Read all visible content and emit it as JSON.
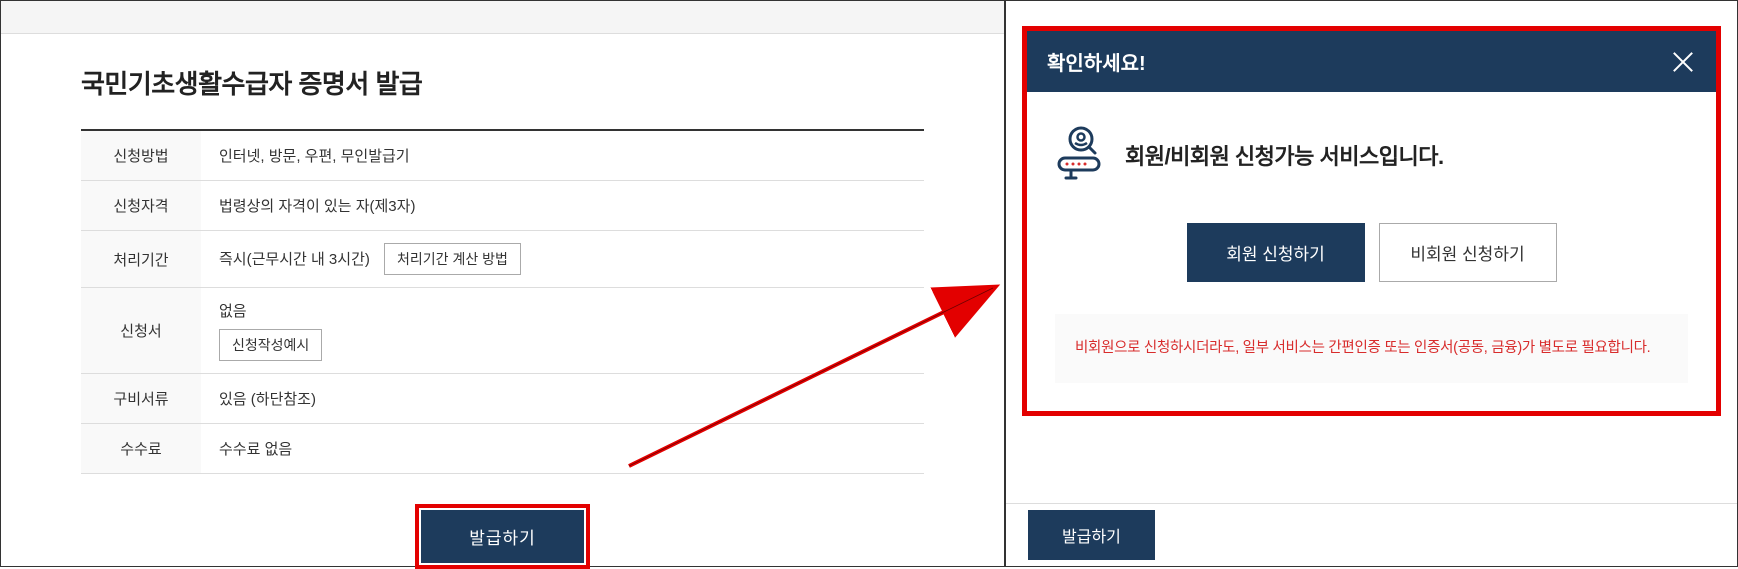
{
  "page": {
    "title": "국민기초생활수급자 증명서 발급"
  },
  "table": {
    "rows": [
      {
        "label": "신청방법",
        "value": "인터넷, 방문, 우편, 무인발급기"
      },
      {
        "label": "신청자격",
        "value": "법령상의 자격이 있는 자(제3자)"
      },
      {
        "label": "처리기간",
        "value": "즉시(근무시간 내 3시간)",
        "button": "처리기간 계산 방법"
      },
      {
        "label": "신청서",
        "value": "없음",
        "button": "신청작성예시",
        "stacked": true
      },
      {
        "label": "구비서류",
        "value": "있음 (하단참조)"
      },
      {
        "label": "수수료",
        "value": "수수료 없음"
      }
    ]
  },
  "actions": {
    "issue": "발급하기"
  },
  "modal": {
    "title": "확인하세요!",
    "message": "회원/비회원 신청가능 서비스입니다.",
    "member_btn": "회원 신청하기",
    "nonmember_btn": "비회원 신청하기",
    "notice": "비회원으로 신청하시더라도, 일부 서비스는 간편인증 또는 인증서(공동, 금융)가 별도로 필요합니다."
  }
}
